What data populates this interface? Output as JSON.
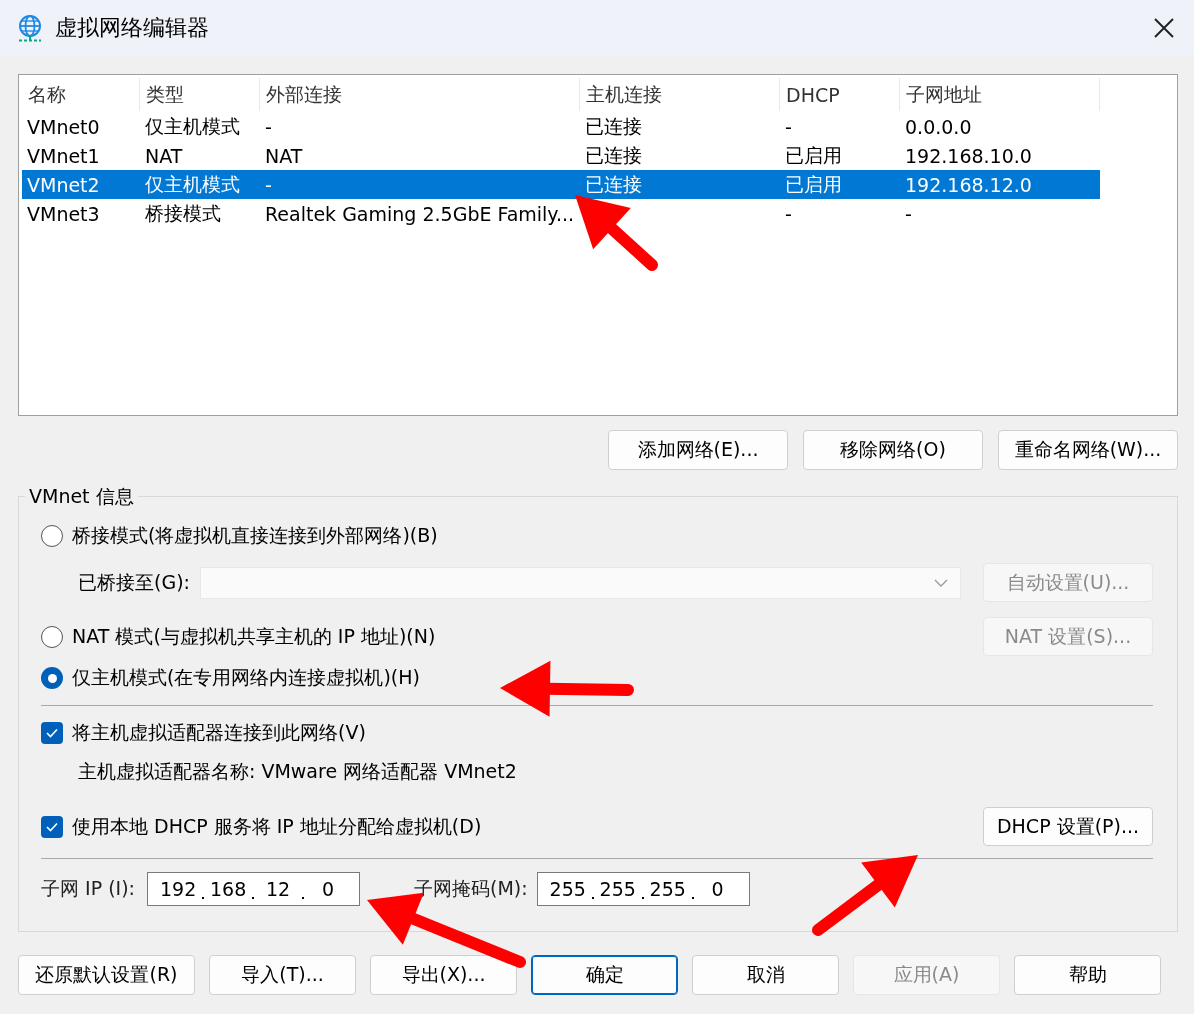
{
  "window": {
    "title": "虚拟网络编辑器"
  },
  "table": {
    "columns": [
      "名称",
      "类型",
      "外部连接",
      "主机连接",
      "DHCP",
      "子网地址"
    ],
    "rows": [
      {
        "cells": [
          "VMnet0",
          "仅主机模式",
          "-",
          "已连接",
          "-",
          "0.0.0.0"
        ],
        "selected": false
      },
      {
        "cells": [
          "VMnet1",
          "NAT",
          "NAT",
          "已连接",
          "已启用",
          "192.168.10.0"
        ],
        "selected": false
      },
      {
        "cells": [
          "VMnet2",
          "仅主机模式",
          "-",
          "已连接",
          "已启用",
          "192.168.12.0"
        ],
        "selected": true
      },
      {
        "cells": [
          "VMnet3",
          "桥接模式",
          "Realtek Gaming 2.5GbE Family...",
          "",
          "-",
          "-"
        ],
        "selected": false
      }
    ]
  },
  "network_buttons": [
    {
      "label": "添加网络(E)...",
      "disabled": false
    },
    {
      "label": "移除网络(O)",
      "disabled": false
    },
    {
      "label": "重命名网络(W)...",
      "disabled": false
    }
  ],
  "vmnet_info": {
    "title": "VMnet 信息",
    "modes": [
      {
        "label": "桥接模式(将虚拟机直接连接到外部网络)(B)",
        "selected": false
      },
      {
        "label": "NAT 模式(与虚拟机共享主机的 IP 地址)(N)",
        "selected": false
      },
      {
        "label": "仅主机模式(在专用网络内连接虚拟机)(H)",
        "selected": true
      }
    ],
    "bridged_to": {
      "label": "已桥接至(G):",
      "disabled": true
    },
    "auto_settings_button": {
      "label": "自动设置(U)...",
      "disabled": true
    },
    "nat_settings_button": {
      "label": "NAT 设置(S)...",
      "disabled": true
    },
    "connect_adapter": {
      "label": "将主机虚拟适配器连接到此网络(V)",
      "checked": true
    },
    "adapter_name": "主机虚拟适配器名称: VMware 网络适配器 VMnet2",
    "use_dhcp": {
      "label": "使用本地 DHCP 服务将 IP 地址分配给虚拟机(D)",
      "checked": true
    },
    "dhcp_settings_button": {
      "label": "DHCP 设置(P)...",
      "disabled": false
    },
    "subnet_ip": {
      "label": "子网 IP (I):",
      "octets": [
        "192",
        "168",
        "12",
        "0"
      ]
    },
    "subnet_mask": {
      "label": "子网掩码(M):",
      "octets": [
        "255",
        "255",
        "255",
        "0"
      ]
    }
  },
  "footer_buttons": [
    {
      "label": "还原默认设置(R)",
      "disabled": false,
      "default": false
    },
    {
      "label": "导入(T)...",
      "disabled": false,
      "default": false
    },
    {
      "label": "导出(X)...",
      "disabled": false,
      "default": false
    },
    {
      "label": "确定",
      "disabled": false,
      "default": true
    },
    {
      "label": "取消",
      "disabled": false,
      "default": false
    },
    {
      "label": "应用(A)",
      "disabled": true,
      "default": false
    },
    {
      "label": "帮助",
      "disabled": false,
      "default": false
    }
  ]
}
